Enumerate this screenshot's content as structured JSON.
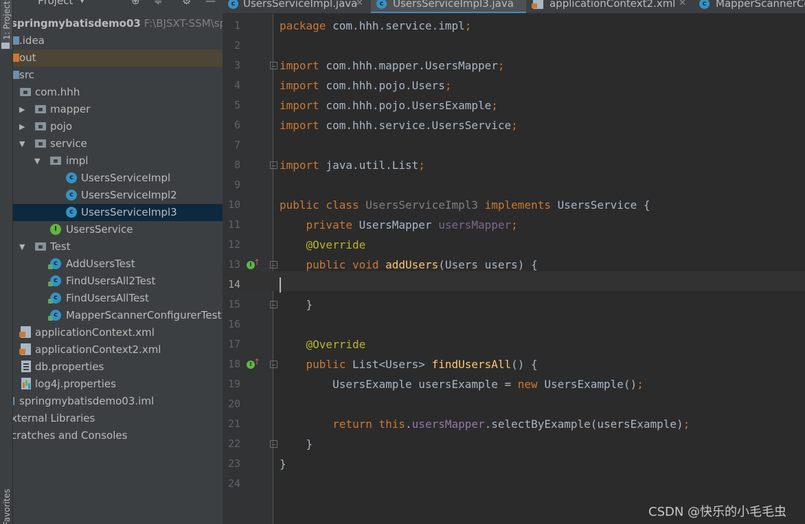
{
  "tool_strip": {
    "project_label": "1: Project",
    "favorites_label": "Favorites"
  },
  "project_panel": {
    "title": "Project",
    "tree": [
      {
        "label": "springmybatisdemo03",
        "path": "F:\\BJSXT-SSM\\spring",
        "icon": "module-folder-icon"
      },
      {
        "label": ".idea",
        "icon": "folder-icon"
      },
      {
        "label": "out",
        "icon": "excluded-folder-icon"
      },
      {
        "label": "src",
        "icon": "source-folder-icon"
      },
      {
        "label": "com.hhh",
        "icon": "package-icon"
      },
      {
        "label": "mapper",
        "icon": "package-icon"
      },
      {
        "label": "pojo",
        "icon": "package-icon"
      },
      {
        "label": "service",
        "icon": "package-icon"
      },
      {
        "label": "impl",
        "icon": "package-icon"
      },
      {
        "label": "UsersServiceImpl",
        "icon": "class-icon"
      },
      {
        "label": "UsersServiceImpl2",
        "icon": "class-icon"
      },
      {
        "label": "UsersServiceImpl3",
        "icon": "class-icon"
      },
      {
        "label": "UsersService",
        "icon": "interface-icon"
      },
      {
        "label": "Test",
        "icon": "package-icon"
      },
      {
        "label": "AddUsersTest",
        "icon": "test-class-icon"
      },
      {
        "label": "FindUsersAll2Test",
        "icon": "test-class-icon"
      },
      {
        "label": "FindUsersAllTest",
        "icon": "test-class-icon"
      },
      {
        "label": "MapperScannerConfigurerTest",
        "icon": "test-class-icon"
      },
      {
        "label": "applicationContext.xml",
        "icon": "xml-file-icon"
      },
      {
        "label": "applicationContext2.xml",
        "icon": "xml-file-icon"
      },
      {
        "label": "db.properties",
        "icon": "properties-file-icon"
      },
      {
        "label": "log4j.properties",
        "icon": "properties-file-icon"
      },
      {
        "label": "springmybatisdemo03.iml",
        "icon": "iml-file-icon"
      },
      {
        "label": "xternal Libraries",
        "icon": "library-icon"
      },
      {
        "label": "cratches and Consoles",
        "icon": "scratches-icon"
      }
    ]
  },
  "tabs": [
    {
      "label": "UsersServiceImpl.java",
      "active": false
    },
    {
      "label": "UsersServiceImpl3.java",
      "active": true
    },
    {
      "label": "applicationContext2.xml",
      "active": false
    },
    {
      "label": "MapperScannerCo",
      "active": false
    }
  ],
  "editor": {
    "current_line": 14,
    "lines": [
      {
        "n": "1",
        "text": "package com.hhh.service.impl;"
      },
      {
        "n": "2",
        "text": ""
      },
      {
        "n": "3",
        "text": "import com.hhh.mapper.UsersMapper;"
      },
      {
        "n": "4",
        "text": "import com.hhh.pojo.Users;"
      },
      {
        "n": "5",
        "text": "import com.hhh.pojo.UsersExample;"
      },
      {
        "n": "6",
        "text": "import com.hhh.service.UsersService;"
      },
      {
        "n": "7",
        "text": ""
      },
      {
        "n": "8",
        "text": "import java.util.List;"
      },
      {
        "n": "9",
        "text": ""
      },
      {
        "n": "10",
        "text": "public class UsersServiceImpl3 implements UsersService {"
      },
      {
        "n": "11",
        "text": "    private UsersMapper usersMapper;"
      },
      {
        "n": "12",
        "text": "    @Override"
      },
      {
        "n": "13",
        "text": "    public void addUsers(Users users) {"
      },
      {
        "n": "14",
        "text": ""
      },
      {
        "n": "15",
        "text": "    }"
      },
      {
        "n": "16",
        "text": ""
      },
      {
        "n": "17",
        "text": "    @Override"
      },
      {
        "n": "18",
        "text": "    public List<Users> findUsersAll() {"
      },
      {
        "n": "19",
        "text": "        UsersExample usersExample = new UsersExample();"
      },
      {
        "n": "20",
        "text": ""
      },
      {
        "n": "21",
        "text": "        return this.usersMapper.selectByExample(usersExample);"
      },
      {
        "n": "22",
        "text": "    }"
      },
      {
        "n": "23",
        "text": "}"
      },
      {
        "n": "24",
        "text": ""
      }
    ]
  },
  "colors": {
    "keyword": "#cc7832",
    "annotation": "#bbb529",
    "method_decl": "#ffc66d",
    "field": "#9876aa",
    "text": "#a9b7c6",
    "selection": "#0d293e",
    "active_tab_underline": "#4a88c7"
  },
  "watermark": "CSDN @快乐的小毛毛虫"
}
